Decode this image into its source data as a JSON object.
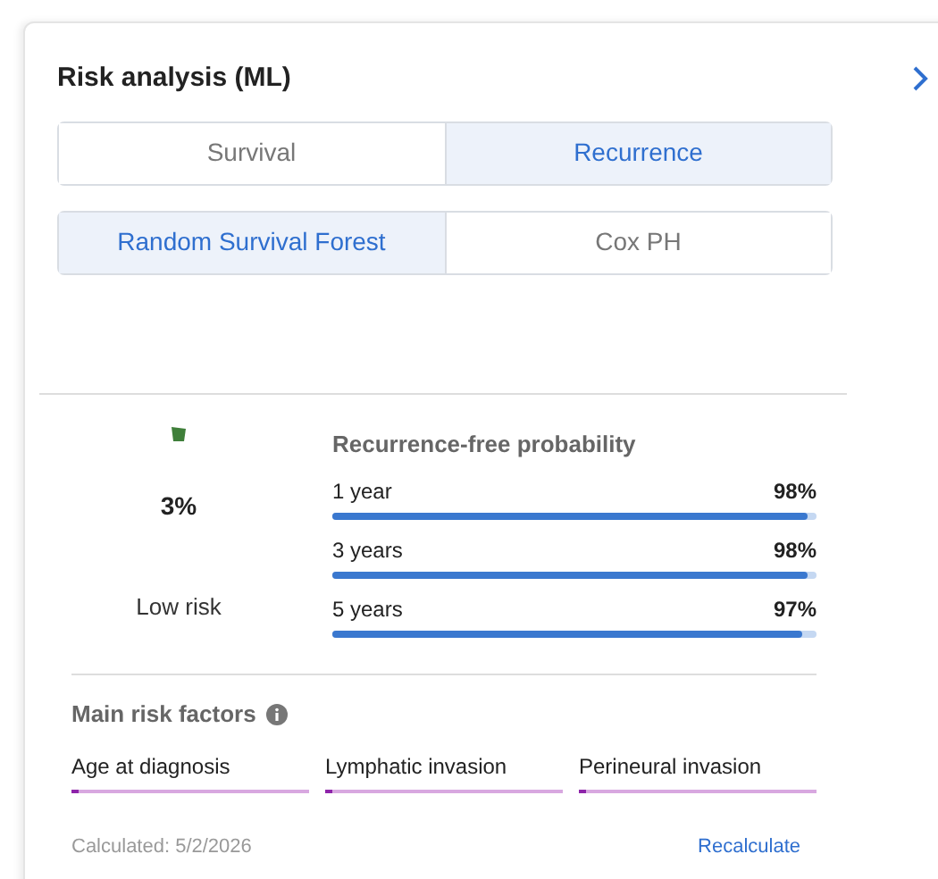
{
  "title": "Risk analysis (ML)",
  "outcome_tabs": [
    {
      "label": "Survival",
      "selected": false
    },
    {
      "label": "Recurrence",
      "selected": true
    }
  ],
  "model_tabs": [
    {
      "label": "Random Survival Forest",
      "selected": true
    },
    {
      "label": "Cox PH",
      "selected": false
    }
  ],
  "risk": {
    "value": "3%",
    "category": "Low risk"
  },
  "probability": {
    "heading": "Recurrence-free probability",
    "rows": [
      {
        "label": "1 year",
        "value": "98%",
        "level": 0.98
      },
      {
        "label": "3 years",
        "value": "98%",
        "level": 0.98
      },
      {
        "label": "5 years",
        "value": "97%",
        "level": 0.97
      }
    ]
  },
  "risk_factors": {
    "heading": "Main risk factors",
    "items": [
      {
        "label": "Age at diagnosis",
        "level": 0.03
      },
      {
        "label": "Lymphatic invasion",
        "level": 0.03
      },
      {
        "label": "Perineural invasion",
        "level": 0.03
      }
    ]
  },
  "footer": {
    "calculated": "Calculated: 5/2/2026",
    "action": "Recalculate"
  }
}
